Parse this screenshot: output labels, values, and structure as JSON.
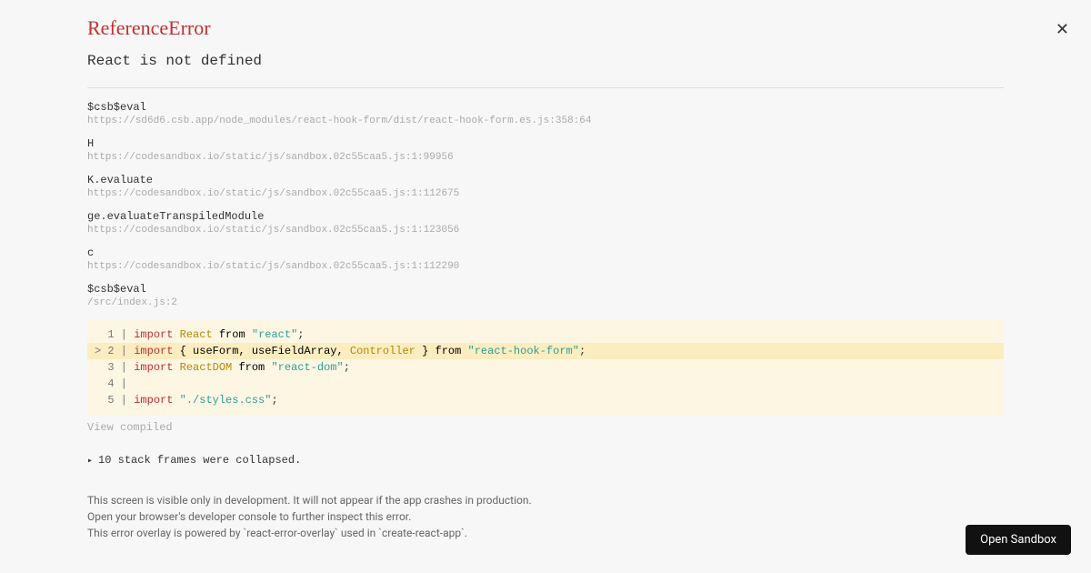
{
  "error": {
    "type": "ReferenceError",
    "message": "React is not defined"
  },
  "stack": {
    "frames": [
      {
        "name": "$csb$eval",
        "url": "https://sd6d6.csb.app/node_modules/react-hook-form/dist/react-hook-form.es.js:358:64"
      },
      {
        "name": "H",
        "url": "https://codesandbox.io/static/js/sandbox.02c55caa5.js:1:99956"
      },
      {
        "name": "K.evaluate",
        "url": "https://codesandbox.io/static/js/sandbox.02c55caa5.js:1:112675"
      },
      {
        "name": "ge.evaluateTranspiledModule",
        "url": "https://codesandbox.io/static/js/sandbox.02c55caa5.js:1:123056"
      },
      {
        "name": "c",
        "url": "https://codesandbox.io/static/js/sandbox.02c55caa5.js:1:112290"
      },
      {
        "name": "$csb$eval",
        "url": "/src/index.js:2"
      }
    ]
  },
  "code": {
    "lines": [
      {
        "n": "1",
        "marker": "  ",
        "kw": "import",
        "ident": "React",
        "mid": " from ",
        "str": "\"react\"",
        "tail": ";"
      },
      {
        "n": "2",
        "marker": "> ",
        "kw": "import",
        "ident2": "{ useForm, useFieldArray, ",
        "controller": "Controller",
        "ident3": " }",
        "mid": " from ",
        "str": "\"react-hook-form\"",
        "tail": ";"
      },
      {
        "n": "3",
        "marker": "  ",
        "kw": "import",
        "ident": "ReactDOM",
        "mid": " from ",
        "str": "\"react-dom\"",
        "tail": ";"
      },
      {
        "n": "4",
        "marker": "  ",
        "kw": "",
        "ident": "",
        "mid": "",
        "str": "",
        "tail": ""
      },
      {
        "n": "5",
        "marker": "  ",
        "kw": "import",
        "ident": "",
        "mid": " ",
        "str": "\"./styles.css\"",
        "tail": ";"
      }
    ]
  },
  "links": {
    "view_compiled": "View compiled",
    "collapsed": "10 stack frames were collapsed."
  },
  "footer": {
    "l1": "This screen is visible only in development. It will not appear if the app crashes in production.",
    "l2": "Open your browser's developer console to further inspect this error.",
    "l3": "This error overlay is powered by `react-error-overlay` used in `create-react-app`."
  },
  "sandbox_button": "Open Sandbox"
}
